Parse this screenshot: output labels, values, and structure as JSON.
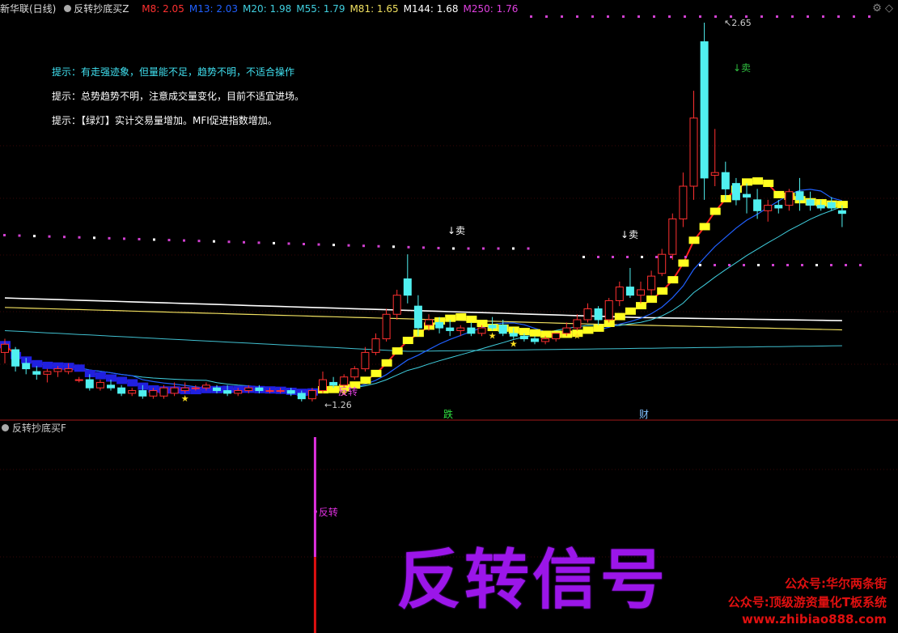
{
  "header": {
    "stock": "新华联(日线)",
    "indicator": "反转抄底买Z",
    "ma": [
      {
        "label": "M8: 2.05",
        "color": "#ff3030"
      },
      {
        "label": "M13: 2.03",
        "color": "#2060ff"
      },
      {
        "label": "M20: 1.98",
        "color": "#40d0e0"
      },
      {
        "label": "M55: 1.79",
        "color": "#40d0e0"
      },
      {
        "label": "M81: 1.65",
        "color": "#f0e060"
      },
      {
        "label": "M144: 1.68",
        "color": "#ffffff"
      },
      {
        "label": "M250: 1.76",
        "color": "#e040e0"
      }
    ]
  },
  "tips": [
    {
      "text": "提示：有走强迹象，但量能不足，趋势不明，不适合操作",
      "color": "#40e0f0"
    },
    {
      "text": "提示：总势趋势不明，注意成交量变化，目前不适宜进场。",
      "color": "#ffffff"
    },
    {
      "text": "提示：【绿灯】实计交易量增加。MFI促进指数增加。",
      "color": "#ffffff"
    }
  ],
  "chart_data": {
    "type": "candlestick",
    "price_high_label": "2.65",
    "price_low_label": "1.26",
    "annotations": [
      {
        "text": "↓卖",
        "color": "#30c040"
      },
      {
        "text": "↓卖",
        "color": "#ffffff"
      },
      {
        "text": "↓卖",
        "color": "#ffffff"
      },
      {
        "text": "反转",
        "color": "#e040e0"
      },
      {
        "text": "跌",
        "color": "#30e040"
      },
      {
        "text": "财",
        "color": "#80c0ff"
      }
    ],
    "candles": [
      [
        1.44,
        1.49,
        1.4,
        1.47
      ],
      [
        1.45,
        1.46,
        1.37,
        1.39
      ],
      [
        1.4,
        1.42,
        1.36,
        1.38
      ],
      [
        1.37,
        1.39,
        1.34,
        1.36
      ],
      [
        1.36,
        1.38,
        1.33,
        1.37
      ],
      [
        1.37,
        1.39,
        1.35,
        1.38
      ],
      [
        1.37,
        1.4,
        1.36,
        1.38
      ],
      [
        1.34,
        1.35,
        1.33,
        1.34
      ],
      [
        1.34,
        1.36,
        1.3,
        1.31
      ],
      [
        1.31,
        1.34,
        1.3,
        1.33
      ],
      [
        1.32,
        1.34,
        1.3,
        1.31
      ],
      [
        1.31,
        1.32,
        1.28,
        1.29
      ],
      [
        1.29,
        1.31,
        1.28,
        1.3
      ],
      [
        1.3,
        1.32,
        1.27,
        1.28
      ],
      [
        1.28,
        1.31,
        1.27,
        1.3
      ],
      [
        1.28,
        1.32,
        1.27,
        1.31
      ],
      [
        1.29,
        1.33,
        1.28,
        1.31
      ],
      [
        1.3,
        1.33,
        1.29,
        1.31
      ],
      [
        1.31,
        1.32,
        1.3,
        1.31
      ],
      [
        1.31,
        1.33,
        1.3,
        1.32
      ],
      [
        1.31,
        1.32,
        1.29,
        1.3
      ],
      [
        1.3,
        1.32,
        1.28,
        1.29
      ],
      [
        1.29,
        1.31,
        1.28,
        1.3
      ],
      [
        1.3,
        1.32,
        1.29,
        1.31
      ],
      [
        1.31,
        1.32,
        1.29,
        1.3
      ],
      [
        1.3,
        1.31,
        1.29,
        1.3
      ],
      [
        1.3,
        1.31,
        1.29,
        1.3
      ],
      [
        1.3,
        1.31,
        1.28,
        1.29
      ],
      [
        1.29,
        1.3,
        1.26,
        1.27
      ],
      [
        1.27,
        1.31,
        1.26,
        1.3
      ],
      [
        1.3,
        1.37,
        1.29,
        1.34
      ],
      [
        1.33,
        1.35,
        1.31,
        1.32
      ],
      [
        1.32,
        1.36,
        1.31,
        1.35
      ],
      [
        1.35,
        1.39,
        1.34,
        1.38
      ],
      [
        1.38,
        1.46,
        1.37,
        1.44
      ],
      [
        1.44,
        1.51,
        1.43,
        1.49
      ],
      [
        1.49,
        1.6,
        1.48,
        1.58
      ],
      [
        1.58,
        1.67,
        1.56,
        1.65
      ],
      [
        1.71,
        1.8,
        1.62,
        1.65
      ],
      [
        1.61,
        1.65,
        1.5,
        1.53
      ],
      [
        1.54,
        1.58,
        1.52,
        1.56
      ],
      [
        1.55,
        1.57,
        1.51,
        1.53
      ],
      [
        1.53,
        1.56,
        1.5,
        1.52
      ],
      [
        1.52,
        1.54,
        1.5,
        1.53
      ],
      [
        1.53,
        1.55,
        1.5,
        1.51
      ],
      [
        1.51,
        1.54,
        1.5,
        1.53
      ],
      [
        1.54,
        1.57,
        1.52,
        1.53
      ],
      [
        1.54,
        1.56,
        1.5,
        1.51
      ],
      [
        1.51,
        1.53,
        1.49,
        1.5
      ],
      [
        1.5,
        1.51,
        1.48,
        1.49
      ],
      [
        1.49,
        1.5,
        1.47,
        1.48
      ],
      [
        1.48,
        1.5,
        1.47,
        1.49
      ],
      [
        1.49,
        1.51,
        1.48,
        1.51
      ],
      [
        1.51,
        1.55,
        1.5,
        1.53
      ],
      [
        1.53,
        1.58,
        1.52,
        1.56
      ],
      [
        1.56,
        1.62,
        1.55,
        1.6
      ],
      [
        1.6,
        1.61,
        1.54,
        1.56
      ],
      [
        1.56,
        1.64,
        1.55,
        1.63
      ],
      [
        1.63,
        1.7,
        1.61,
        1.68
      ],
      [
        1.68,
        1.75,
        1.64,
        1.65
      ],
      [
        1.65,
        1.7,
        1.62,
        1.67
      ],
      [
        1.67,
        1.74,
        1.65,
        1.72
      ],
      [
        1.73,
        1.82,
        1.72,
        1.8
      ],
      [
        1.8,
        1.95,
        1.78,
        1.93
      ],
      [
        1.93,
        2.1,
        1.9,
        2.05
      ],
      [
        2.05,
        2.4,
        2.0,
        2.3
      ],
      [
        2.58,
        2.65,
        2.0,
        2.08
      ],
      [
        2.09,
        2.26,
        2.05,
        2.1
      ],
      [
        2.1,
        2.14,
        2.0,
        2.04
      ],
      [
        2.06,
        2.08,
        1.98,
        2.0
      ],
      [
        2.02,
        2.06,
        1.95,
        2.01
      ],
      [
        2.0,
        2.04,
        1.93,
        1.96
      ],
      [
        1.96,
        2.0,
        1.92,
        1.98
      ],
      [
        1.98,
        2.0,
        1.95,
        1.97
      ],
      [
        1.98,
        2.04,
        1.96,
        2.03
      ],
      [
        2.03,
        2.08,
        1.96,
        2.0
      ],
      [
        2.0,
        2.03,
        1.96,
        1.98
      ],
      [
        1.98,
        2.0,
        1.96,
        1.97
      ],
      [
        1.99,
        2.01,
        1.96,
        1.97
      ],
      [
        1.96,
        1.98,
        1.9,
        1.95
      ]
    ],
    "sub_chart": {
      "title": "反转抄底买F",
      "signal_label": "反转",
      "signal_index": 29
    }
  },
  "watermark": {
    "title": "反转信号",
    "lines": [
      "公众号:华尔两条街",
      "公众号:顶级游资量化T板系统",
      "www.zhibiao888.com"
    ]
  }
}
